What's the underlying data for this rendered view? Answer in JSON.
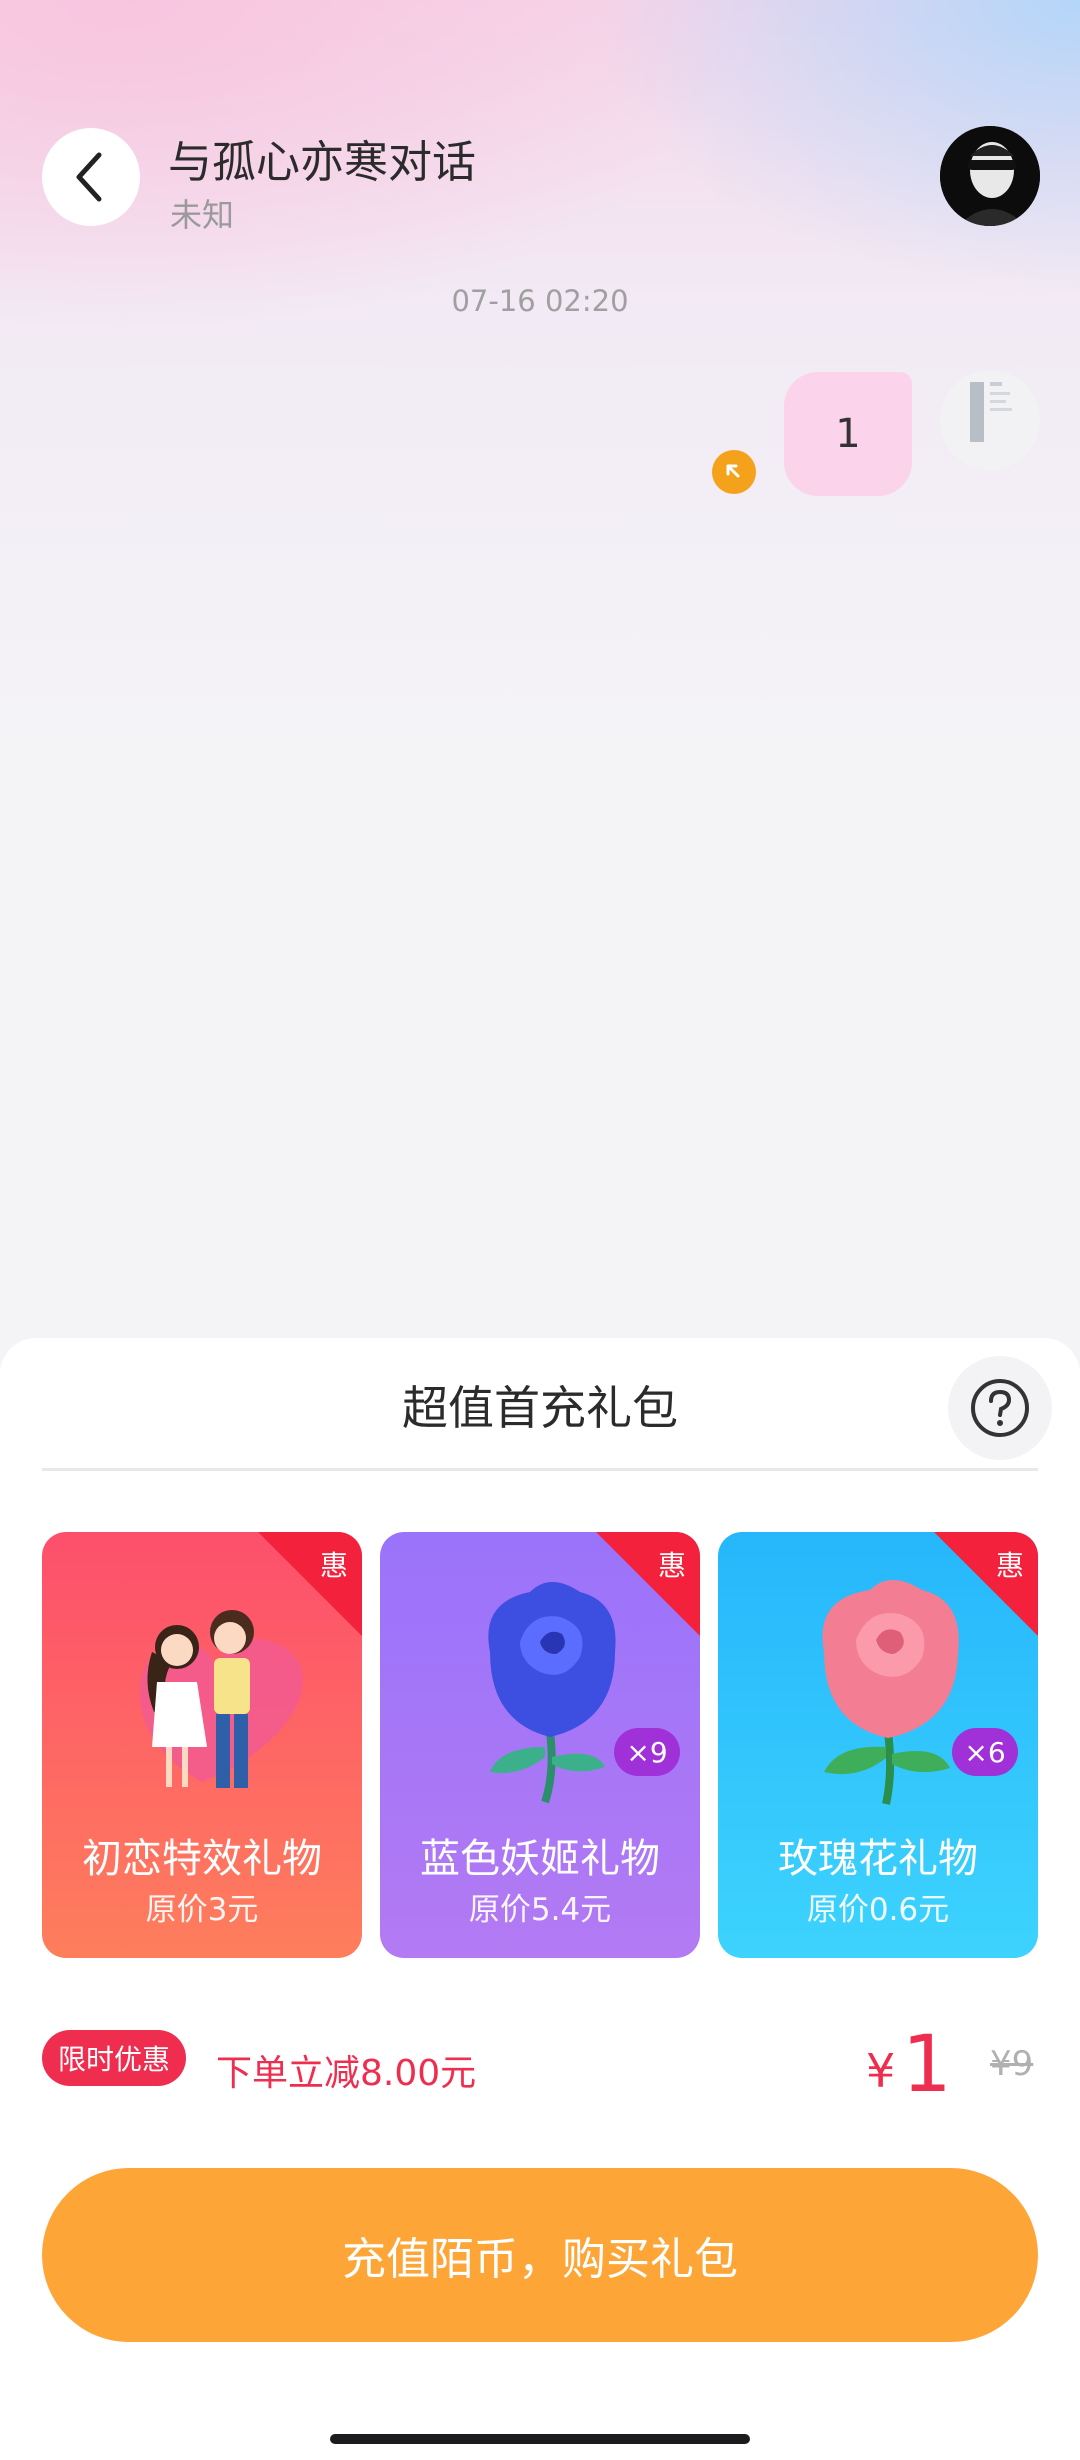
{
  "header": {
    "title": "与孤心亦寒对话",
    "subtitle": "未知"
  },
  "chat": {
    "timestamp": "07-16 02:20",
    "messages": [
      {
        "text": "1",
        "from": "me"
      }
    ]
  },
  "sheet": {
    "title": "超值首充礼包",
    "cards": [
      {
        "name": "初恋特效礼物",
        "original_price": "原价3元",
        "ribbon": "惠",
        "count_badge": ""
      },
      {
        "name": "蓝色妖姬礼物",
        "original_price": "原价5.4元",
        "ribbon": "惠",
        "count_badge": "×9"
      },
      {
        "name": "玫瑰花礼物",
        "original_price": "原价0.6元",
        "ribbon": "惠",
        "count_badge": "×6"
      }
    ],
    "promo_badge": "限时优惠",
    "promo_text": "下单立减8.00元",
    "currency_symbol": "¥",
    "price": "1",
    "original_price": "¥9",
    "buy_button": "充值陌币，购买礼包"
  },
  "colors": {
    "accent_red": "#ef2d4f",
    "button_orange": "#fea538",
    "bubble_pink": "#fbd3ea"
  },
  "icons": {
    "back": "chevron-left-icon",
    "help": "question-circle-icon",
    "status": "arrow-up-left-icon"
  }
}
